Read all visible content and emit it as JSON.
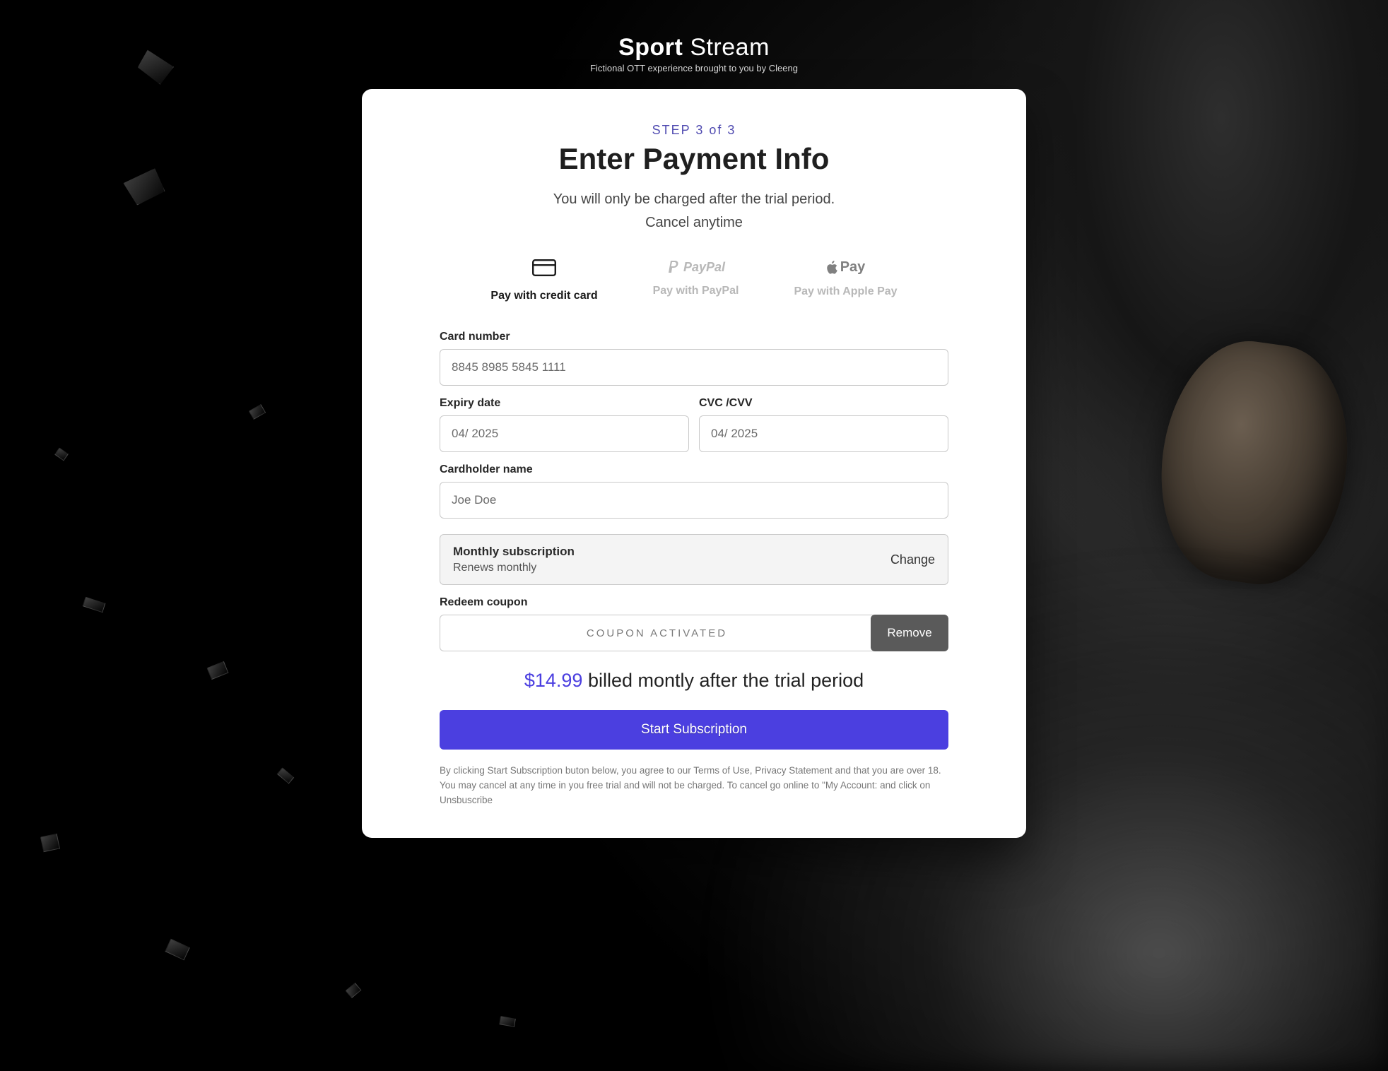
{
  "brand": {
    "name_bold": "Sport",
    "name_light": "Stream",
    "tagline": "Fictional OTT experience brought to you by Cleeng"
  },
  "header": {
    "step": "STEP 3 of 3",
    "title": "Enter Payment Info",
    "sub1": "You will only be charged after the trial  period.",
    "sub2": "Cancel anytime"
  },
  "methods": {
    "credit_card": "Pay with credit card",
    "paypal": "Pay with PayPal",
    "apple_pay": "Pay with Apple Pay",
    "paypal_brand": "PayPal",
    "applepay_brand": "Pay"
  },
  "form": {
    "card_number_label": "Card number",
    "card_number_value": "8845 8985 5845 1111",
    "expiry_label": "Expiry date",
    "expiry_value": "04/ 2025",
    "cvc_label": "CVC /CVV",
    "cvc_value": "04/ 2025",
    "holder_label": "Cardholder name",
    "holder_value": "Joe Doe"
  },
  "plan": {
    "name": "Monthly subscription",
    "renews": "Renews monthly",
    "change": "Change"
  },
  "coupon": {
    "label": "Redeem coupon",
    "status": "COUPON ACTIVATED",
    "remove": "Remove"
  },
  "price": {
    "amount": "$14.99",
    "suffix": " billed montly after the trial period"
  },
  "cta": "Start Subscription",
  "legal": "By clicking Start Subscription buton below, you agree to our Terms of Use, Privacy Statement and that you are over 18. You may cancel at any time in you free trial and will not be charged. To cancel go online to \"My Account: and click on Unsbuscribe"
}
